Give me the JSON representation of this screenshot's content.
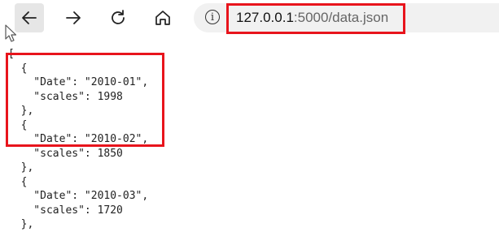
{
  "toolbar": {
    "back_icon": "arrow-left-icon",
    "forward_icon": "arrow-right-icon",
    "refresh_icon": "refresh-icon",
    "home_icon": "home-icon"
  },
  "address_bar": {
    "info_icon": "i",
    "url_host": "127.0.0.1",
    "url_rest": ":5000/data.json"
  },
  "annotations": {
    "highlight_color": "#e8141c"
  },
  "json_lines": [
    "[",
    "  {",
    "    \"Date\": \"2010-01\",",
    "    \"scales\": 1998",
    "  },",
    "  {",
    "    \"Date\": \"2010-02\",",
    "    \"scales\": 1850",
    "  },",
    "  {",
    "    \"Date\": \"2010-03\",",
    "    \"scales\": 1720",
    "  },"
  ]
}
